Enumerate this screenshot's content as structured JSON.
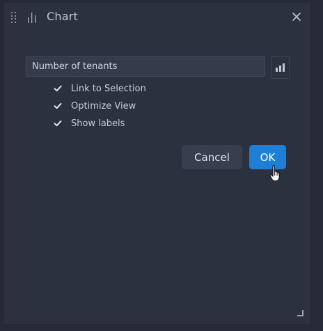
{
  "dialog": {
    "title": "Chart",
    "close_icon": "close-icon",
    "drag_icon": "drag-handle-icon",
    "title_icon": "bar-chart-icon"
  },
  "field": {
    "value": "Number of tenants",
    "button_icon": "chart-type-icon"
  },
  "options": [
    {
      "label": "Link to Selection",
      "checked": true
    },
    {
      "label": "Optimize View",
      "checked": true
    },
    {
      "label": "Show labels",
      "checked": true
    }
  ],
  "buttons": {
    "cancel_label": "Cancel",
    "ok_label": "OK"
  },
  "colors": {
    "background": "#262a36",
    "panel": "#2c3140",
    "accent": "#1f7fd6",
    "secondary_button": "#383e4e"
  }
}
